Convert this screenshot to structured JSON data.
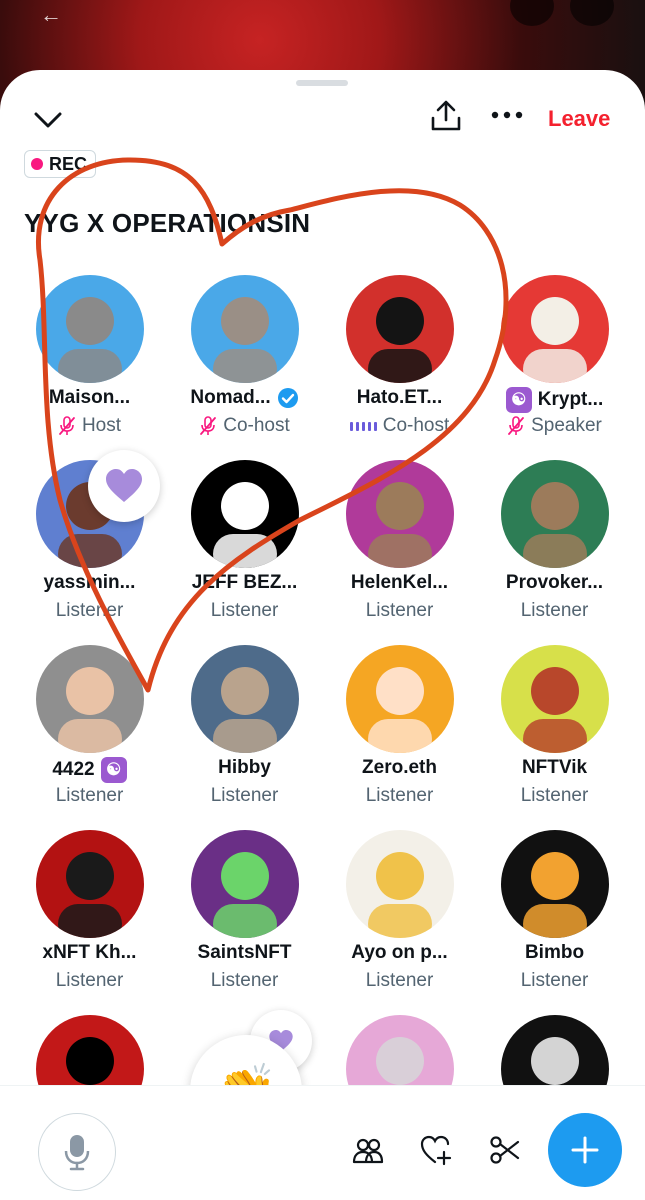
{
  "header": {
    "leave_label": "Leave",
    "rec_label": "REC"
  },
  "space": {
    "title": "YYG X OPERATIONSIN"
  },
  "colors": {
    "accent": "#1d9bf0",
    "leave": "#f4212e",
    "rec_dot": "#f91880",
    "annotation": "#d9441c"
  },
  "participants": [
    {
      "name": "Maison...",
      "role": "Host",
      "mic": "muted"
    },
    {
      "name": "Nomad...",
      "role": "Co-host",
      "mic": "muted",
      "verified": true
    },
    {
      "name": "Hato.ET...",
      "role": "Co-host",
      "mic": "speaking"
    },
    {
      "name": "Krypt...",
      "role": "Speaker",
      "mic": "muted",
      "badge": "☯"
    },
    {
      "name": "yassmin...",
      "role": "Listener"
    },
    {
      "name": "JEFF BEZ...",
      "role": "Listener"
    },
    {
      "name": "HelenKel...",
      "role": "Listener"
    },
    {
      "name": "Provoker...",
      "role": "Listener"
    },
    {
      "name": "4422",
      "role": "Listener",
      "badge": "☯"
    },
    {
      "name": "Hibby",
      "role": "Listener"
    },
    {
      "name": "Zero.eth",
      "role": "Listener"
    },
    {
      "name": "NFTVik",
      "role": "Listener"
    },
    {
      "name": "xNFT Kh...",
      "role": "Listener"
    },
    {
      "name": "SaintsNFT",
      "role": "Listener"
    },
    {
      "name": "Ayo on p...",
      "role": "Listener"
    },
    {
      "name": "Bimbo",
      "role": "Listener"
    },
    {
      "name": "",
      "role": ""
    },
    {
      "name": "",
      "role": ""
    },
    {
      "name": "",
      "role": ""
    },
    {
      "name": "",
      "role": ""
    }
  ],
  "reactions": {
    "clap_emoji": "👏"
  },
  "icons": {
    "back": "back-arrow-icon",
    "collapse": "chevron-down-icon",
    "share": "share-icon",
    "more": "more-icon",
    "mic": "microphone-icon",
    "people": "people-icon",
    "heart_add": "heart-add-icon",
    "clip": "scissors-icon",
    "add": "plus-icon"
  }
}
